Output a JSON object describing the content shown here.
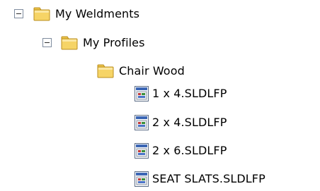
{
  "tree": {
    "nodes": [
      {
        "label": "My Weldments",
        "type": "folder",
        "icon": "folder-icon",
        "expander": "minus"
      },
      {
        "label": "My Profiles",
        "type": "folder",
        "icon": "folder-icon",
        "expander": "minus"
      },
      {
        "label": "Chair Wood",
        "type": "folder",
        "icon": "folder-icon"
      },
      {
        "label": "1 x 4.SLDLFP",
        "type": "file",
        "icon": "sldlfp-file-icon"
      },
      {
        "label": "2 x 4.SLDLFP",
        "type": "file",
        "icon": "sldlfp-file-icon"
      },
      {
        "label": "2 x 6.SLDLFP",
        "type": "file",
        "icon": "sldlfp-file-icon"
      },
      {
        "label": "SEAT SLATS.SLDLFP",
        "type": "file",
        "icon": "sldlfp-file-icon"
      }
    ]
  },
  "colors": {
    "folder_fill": "#f6d466",
    "folder_tab": "#eec54a",
    "folder_outline": "#b98e1f",
    "file_frame": "#5b6c86",
    "file_titlebar": "#3b66b5",
    "expander_border": "#7f8c9e"
  }
}
